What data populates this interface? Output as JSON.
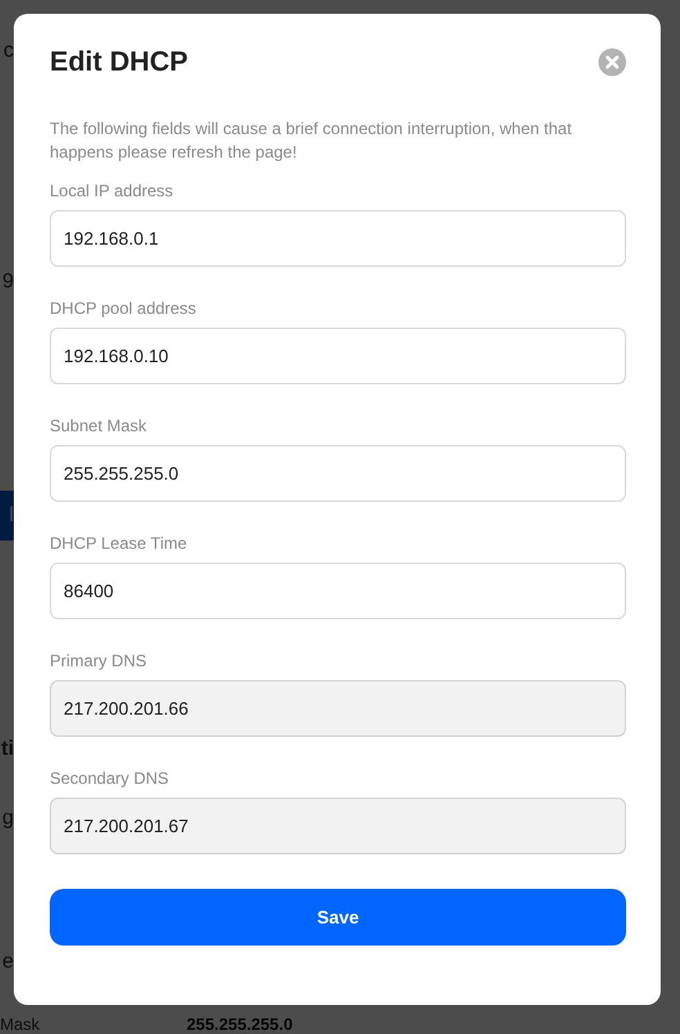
{
  "background": {
    "fragments": [
      {
        "text": "c",
        "kind": "plain"
      },
      {
        "text": "9",
        "kind": "plain"
      },
      {
        "text": "l",
        "kind": "button"
      },
      {
        "text": "ti",
        "kind": "bold"
      },
      {
        "text": "g",
        "kind": "plain"
      },
      {
        "text": "e",
        "kind": "plain"
      }
    ],
    "bottom_row": {
      "label": "Mask",
      "value": "255.255.255.0"
    }
  },
  "dialog": {
    "title": "Edit DHCP",
    "notice": "The following fields will cause a brief connection interruption, when that happens please refresh the page!",
    "fields": [
      {
        "label": "Local IP address",
        "value": "192.168.0.1",
        "readonly": false
      },
      {
        "label": "DHCP pool address",
        "value": "192.168.0.10",
        "readonly": false
      },
      {
        "label": "Subnet Mask",
        "value": "255.255.255.0",
        "readonly": false
      },
      {
        "label": "DHCP Lease Time",
        "value": "86400",
        "readonly": false
      },
      {
        "label": "Primary DNS",
        "value": "217.200.201.66",
        "readonly": true
      },
      {
        "label": "Secondary DNS",
        "value": "217.200.201.67",
        "readonly": true
      }
    ],
    "button": "Save"
  }
}
